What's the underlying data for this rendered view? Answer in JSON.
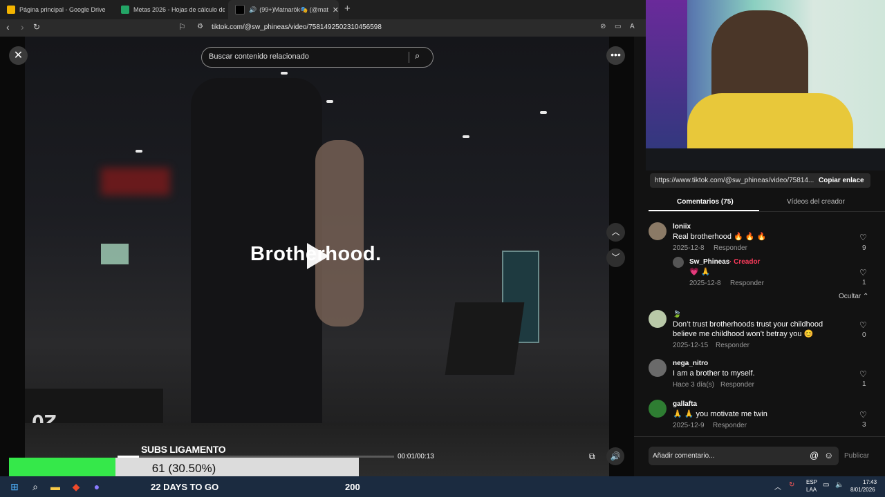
{
  "browser": {
    "tabs": [
      {
        "title": "Página principal - Google Drive",
        "icon": "google-drive-icon",
        "color": "#f4b400"
      },
      {
        "title": "Metas 2026 - Hojas de cálculo de Go",
        "icon": "sheets-icon",
        "color": "#23a566"
      },
      {
        "title": "(99+)Matnarök🎭 (@matnar",
        "icon": "tiktok-icon",
        "color": "#000000",
        "active": true
      }
    ],
    "new_tab": "+",
    "close_tab": "✕",
    "url": "tiktok.com/@sw_phineas/video/7581492502310456598"
  },
  "video": {
    "search_placeholder": "Buscar contenido relacionado",
    "overlay_text": "Brotherhood.",
    "time": "00:01/00:13",
    "progress": 0.077
  },
  "stream_widget": {
    "title": "SUBS LIGAMENTO",
    "progress_text": "61 (30.50%)",
    "progress": 0.305,
    "days": "22 DAYS TO GO",
    "goal": "200",
    "fill_color": "#35e84a"
  },
  "panel": {
    "link": "https://www.tiktok.com/@sw_phineas/video/75814...",
    "copy_label": "Copiar enlace",
    "tab_comments": "Comentarios (75)",
    "tab_videos": "Vídeos del creador",
    "comments": [
      {
        "user": "loniix",
        "text": "Real brotherhood 🔥 🔥 🔥",
        "date": "2025-12-8",
        "reply": "Responder",
        "likes": "9"
      },
      {
        "user": "Sw_Phineas",
        "creator_tag": "· Creador",
        "text": "💗 🙏",
        "date": "2025-12-8",
        "reply": "Responder",
        "likes": "1"
      },
      {
        "user": "🍃",
        "text": "Don’t trust brotherhoods trust your childhood believe me childhood won’t betray you 😊",
        "date": "2025-12-15",
        "reply": "Responder",
        "likes": "0"
      },
      {
        "user": "nega_nitro",
        "text": "I am a brother to myself.",
        "date": "Hace 3 día(s)",
        "reply": "Responder",
        "likes": "1"
      },
      {
        "user": "gallafta",
        "text": "🙏 🙏 you motivate me twin",
        "date": "2025-12-9",
        "reply": "Responder",
        "likes": "3"
      }
    ],
    "hide_label": "Ocultar ⌃",
    "comment_placeholder": "Añadir comentario...",
    "publish": "Publicar"
  },
  "taskbar": {
    "lang1": "ESP",
    "lang2": "LAA",
    "time": "17:43",
    "date": "8/01/2026"
  }
}
